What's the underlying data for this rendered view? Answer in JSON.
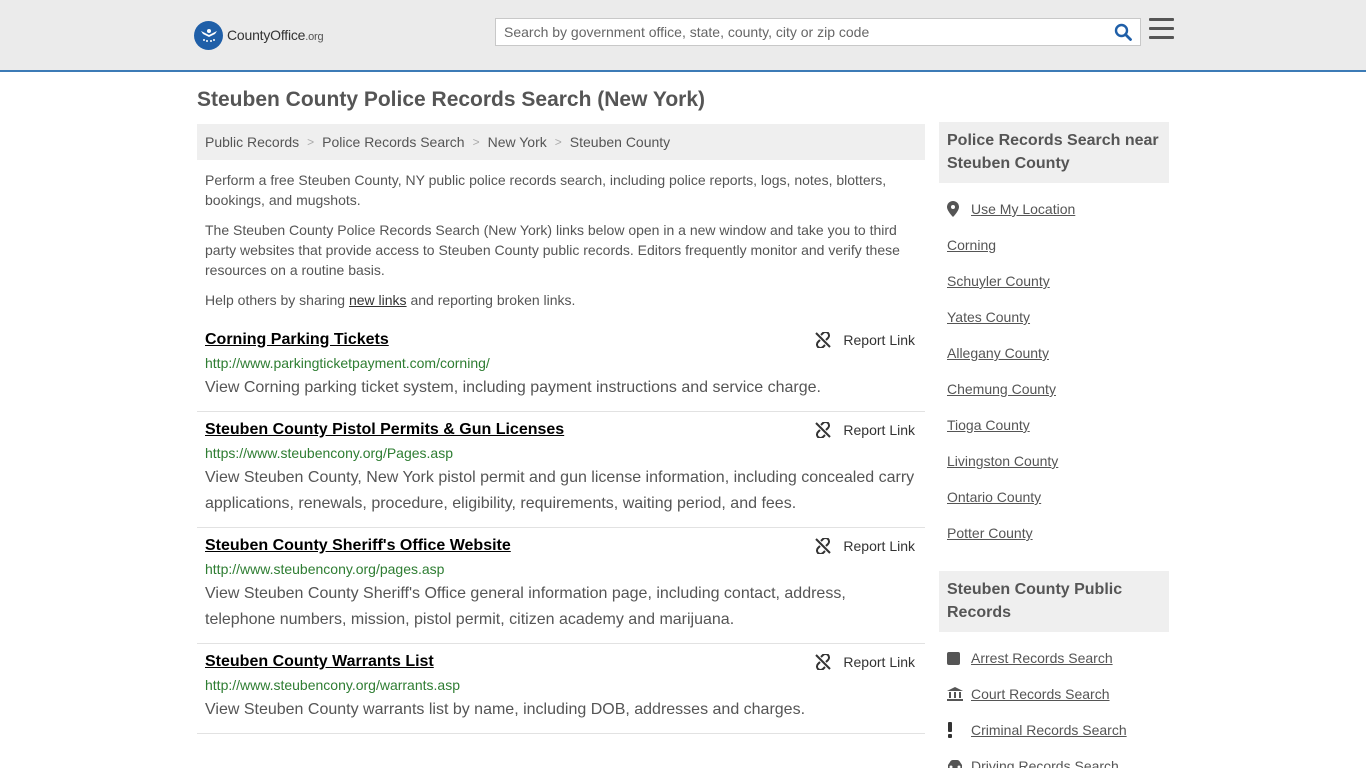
{
  "header": {
    "logo_name": "CountyOffice",
    "logo_tld": ".org",
    "search_placeholder": "Search by government office, state, county, city or zip code"
  },
  "page": {
    "title": "Steuben County Police Records Search (New York)"
  },
  "breadcrumb": [
    "Public Records",
    "Police Records Search",
    "New York",
    "Steuben County"
  ],
  "intro": {
    "p1": "Perform a free Steuben County, NY public police records search, including police reports, logs, notes, blotters, bookings, and mugshots.",
    "p2": "The Steuben County Police Records Search (New York) links below open in a new window and take you to third party websites that provide access to Steuben County public records. Editors frequently monitor and verify these resources on a routine basis.",
    "p3_before": "Help others by sharing ",
    "p3_link": "new links",
    "p3_after": " and reporting broken links."
  },
  "report_label": "Report Link",
  "results": [
    {
      "title": "Corning Parking Tickets",
      "url": "http://www.parkingticketpayment.com/corning/",
      "desc": "View Corning parking ticket system, including payment instructions and service charge."
    },
    {
      "title": "Steuben County Pistol Permits & Gun Licenses",
      "url": "https://www.steubencony.org/Pages.asp",
      "desc": "View Steuben County, New York pistol permit and gun license information, including concealed carry applications, renewals, procedure, eligibility, requirements, waiting period, and fees."
    },
    {
      "title": "Steuben County Sheriff's Office Website",
      "url": "http://www.steubencony.org/pages.asp",
      "desc": "View Steuben County Sheriff's Office general information page, including contact, address, telephone numbers, mission, pistol permit, citizen academy and marijuana."
    },
    {
      "title": "Steuben County Warrants List",
      "url": "http://www.steubencony.org/warrants.asp",
      "desc": "View Steuben County warrants list by name, including DOB, addresses and charges."
    }
  ],
  "sidebar": {
    "nearby_heading": "Police Records Search near Steuben County",
    "use_location": "Use My Location",
    "nearby": [
      "Corning",
      "Schuyler County",
      "Yates County",
      "Allegany County",
      "Chemung County",
      "Tioga County",
      "Livingston County",
      "Ontario County",
      "Potter County"
    ],
    "public_heading": "Steuben County Public Records",
    "public": [
      {
        "label": "Arrest Records Search",
        "icon": "square-icon"
      },
      {
        "label": "Court Records Search",
        "icon": "courthouse-icon"
      },
      {
        "label": "Criminal Records Search",
        "icon": "exclamation-icon"
      },
      {
        "label": "Driving Records Search",
        "icon": "car-icon"
      }
    ]
  },
  "colors": {
    "header_bg": "#ebebeb",
    "header_border": "#3c7bb6",
    "url_green": "#2e7d32",
    "logo_blue": "#1f5fa8"
  }
}
